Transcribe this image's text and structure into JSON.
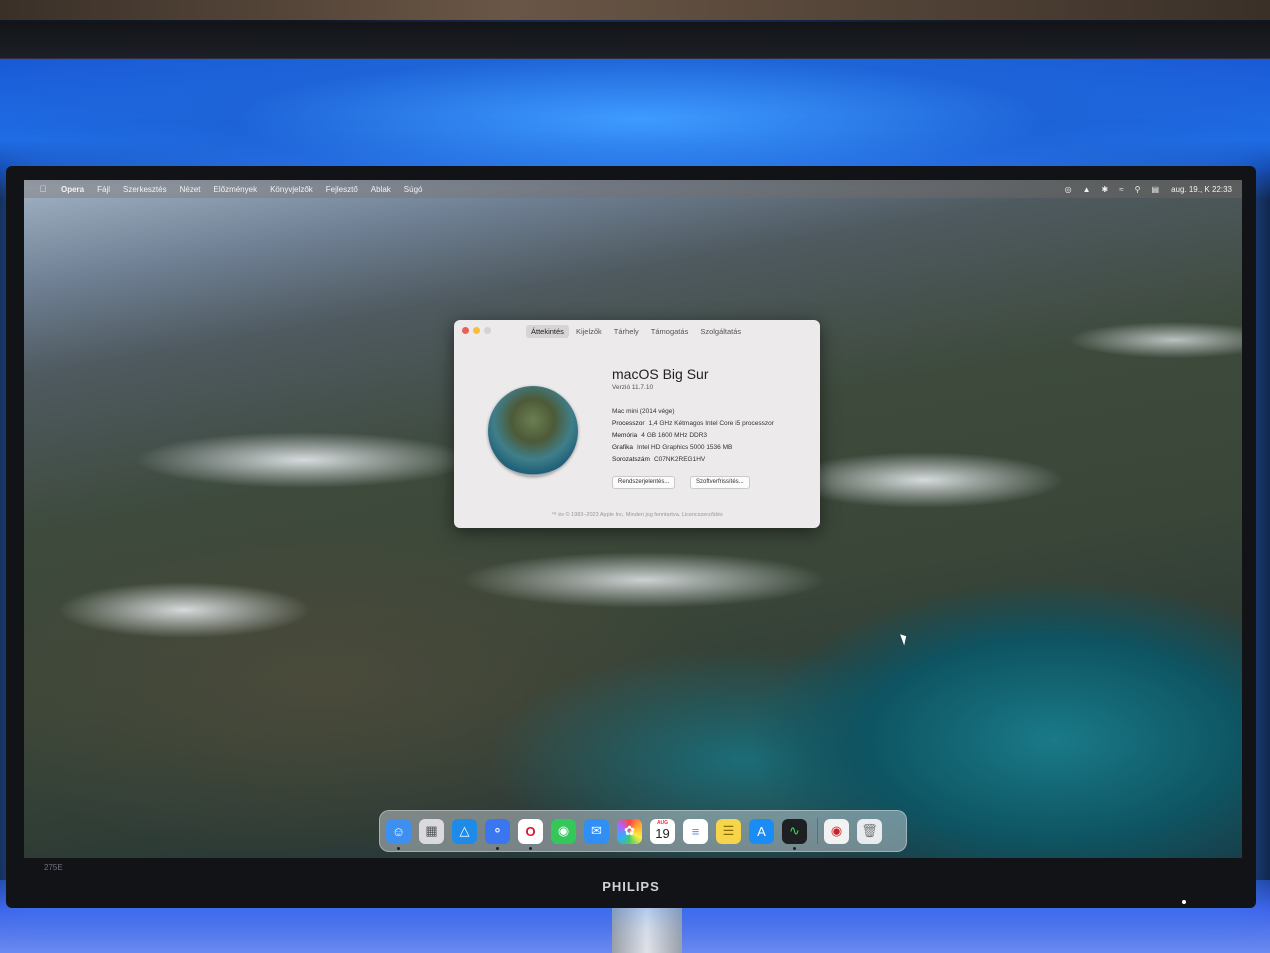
{
  "menubar": {
    "app_name": "Opera",
    "items": [
      "Fájl",
      "Szerkesztés",
      "Nézet",
      "Előzmények",
      "Könyvjelzők",
      "Fejlesztő",
      "Ablak",
      "Súgó"
    ],
    "status_icons": [
      "play-icon",
      "airplay-icon",
      "bluetooth-icon",
      "wifi-icon",
      "search-icon",
      "control-center-icon"
    ],
    "clock": "aug. 19., K  22:33"
  },
  "about_window": {
    "tabs": [
      "Áttekintés",
      "Kijelzők",
      "Tárhely",
      "Támogatás",
      "Szolgáltatás"
    ],
    "active_tab": "Áttekintés",
    "os_name_light": "macOS",
    "os_name_bold": "Big Sur",
    "version": "Verzió 11.7.10",
    "model": "Mac mini (2014 vége)",
    "specs": [
      {
        "key": "Processzor",
        "value": "1,4 GHz Kétmagos Intel Core i5 processzor"
      },
      {
        "key": "Memória",
        "value": "4 GB 1600 MHz DDR3"
      },
      {
        "key": "Grafika",
        "value": "Intel HD Graphics 5000 1536 MB"
      },
      {
        "key": "Sorozatszám",
        "value": "C07NK2REG1HV"
      }
    ],
    "buttons": {
      "system_report": "Rendszerjelentés...",
      "software_update": "Szoftverfrissítés..."
    },
    "copyright": "™ és © 1983–2023 Apple Inc. Minden jog fenntartva. Licencszerződés"
  },
  "dock": {
    "calendar_month": "AUG",
    "calendar_day": "19",
    "colors": {
      "finder": "#3d8ff0",
      "launchpad": "#d9d9de",
      "affinity": "#1f8be8",
      "signal": "#3a76f0",
      "opera": "#ffffff",
      "messages": "#34c759",
      "mail": "#2f8ff5",
      "photos": "#ffffff",
      "reminders": "#ffffff",
      "notes": "#f7d54a",
      "appstore": "#1a8cf4",
      "activity_monitor": "#1d1f22",
      "trash": "#e8ecef"
    }
  },
  "monitor": {
    "brand": "PHILIPS",
    "model": "275E"
  }
}
